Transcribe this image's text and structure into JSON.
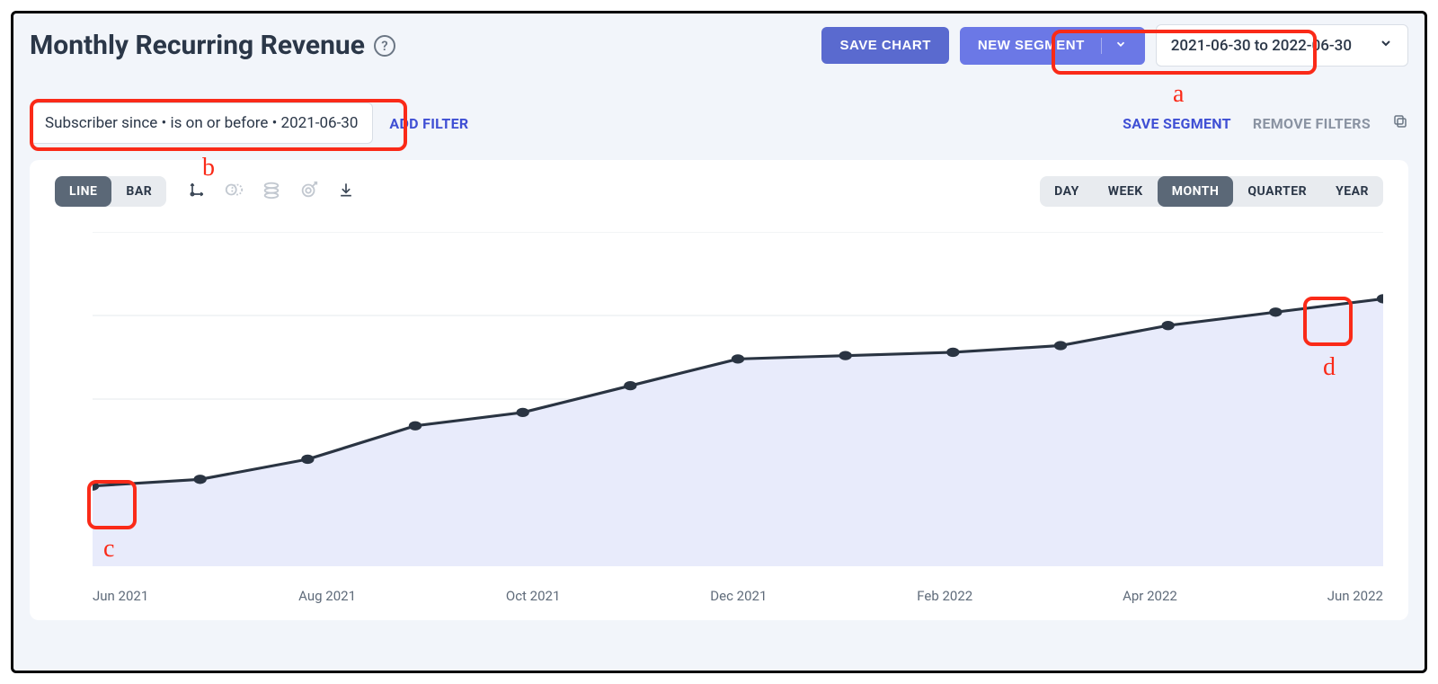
{
  "title": "Monthly Recurring Revenue",
  "buttons": {
    "save_chart": "SAVE CHART",
    "new_segment": "NEW SEGMENT"
  },
  "date_range": "2021-06-30 to 2022-06-30",
  "filter_chip": "Subscriber since • is on or before • 2021-06-30",
  "add_filter": "ADD FILTER",
  "save_segment": "SAVE SEGMENT",
  "remove_filters": "REMOVE FILTERS",
  "chart_type": {
    "line": "LINE",
    "bar": "BAR"
  },
  "granularity": {
    "day": "DAY",
    "week": "WEEK",
    "month": "MONTH",
    "quarter": "QUARTER",
    "year": "YEAR"
  },
  "xaxis_labels": [
    "Jun 2021",
    "Aug 2021",
    "Oct 2021",
    "Dec 2021",
    "Feb 2022",
    "Apr 2022",
    "Jun 2022"
  ],
  "annotations": {
    "a": "a",
    "b": "b",
    "c": "c",
    "d": "d"
  },
  "chart_data": {
    "type": "line",
    "title": "Monthly Recurring Revenue",
    "xlabel": "",
    "ylabel": "",
    "categories": [
      "Jun 2021",
      "Jul 2021",
      "Aug 2021",
      "Sep 2021",
      "Oct 2021",
      "Nov 2021",
      "Dec 2021",
      "Jan 2022",
      "Feb 2022",
      "Mar 2022",
      "Apr 2022",
      "May 2022",
      "Jun 2022"
    ],
    "values": [
      24,
      26,
      32,
      42,
      46,
      54,
      62,
      63,
      64,
      66,
      72,
      76,
      80
    ],
    "ylim": [
      0,
      100
    ]
  }
}
